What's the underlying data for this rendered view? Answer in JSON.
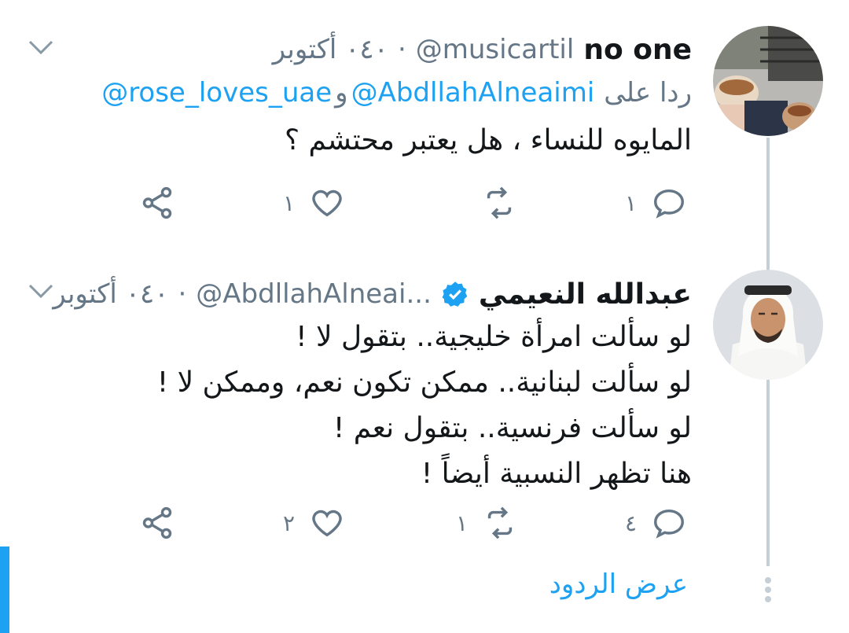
{
  "tweets": [
    {
      "name": "no one",
      "handle": "@musicartil",
      "dot": "·",
      "time": "٠٤٠ أكتوبر",
      "reply_prefix": "ردا على",
      "reply_to": [
        "@AbdllahAlneaimi",
        "@rose_loves_uae"
      ],
      "reply_joiner": "و",
      "lines": [
        "المايوه للنساء ، هل يعتبر محتشم ؟"
      ],
      "counts": {
        "reply": "١",
        "retweet": "",
        "like": "١"
      },
      "avatar_icon": "photo-avatar-hands-cake"
    },
    {
      "name": "عبدالله النعيمي",
      "verified": true,
      "handle": "@AbdllahAlneai...",
      "dot": "·",
      "time": "٠٤٠ أكتوبر",
      "lines": [
        "لو سألت امرأة خليجية.. بتقول لا !",
        "لو سألت لبنانية.. ممكن تكون نعم، وممكن لا !",
        "لو سألت فرنسية.. بتقول نعم !",
        "هنا تظهر النسبية أيضاً !"
      ],
      "counts": {
        "reply": "٤",
        "retweet": "١",
        "like": "٢"
      },
      "avatar_icon": "photo-avatar-man-ghutra"
    }
  ],
  "show_replies": "عرض الردود",
  "colors": {
    "accent": "#1da1f2",
    "secondary": "#657786",
    "thread": "#c4cfd6"
  }
}
